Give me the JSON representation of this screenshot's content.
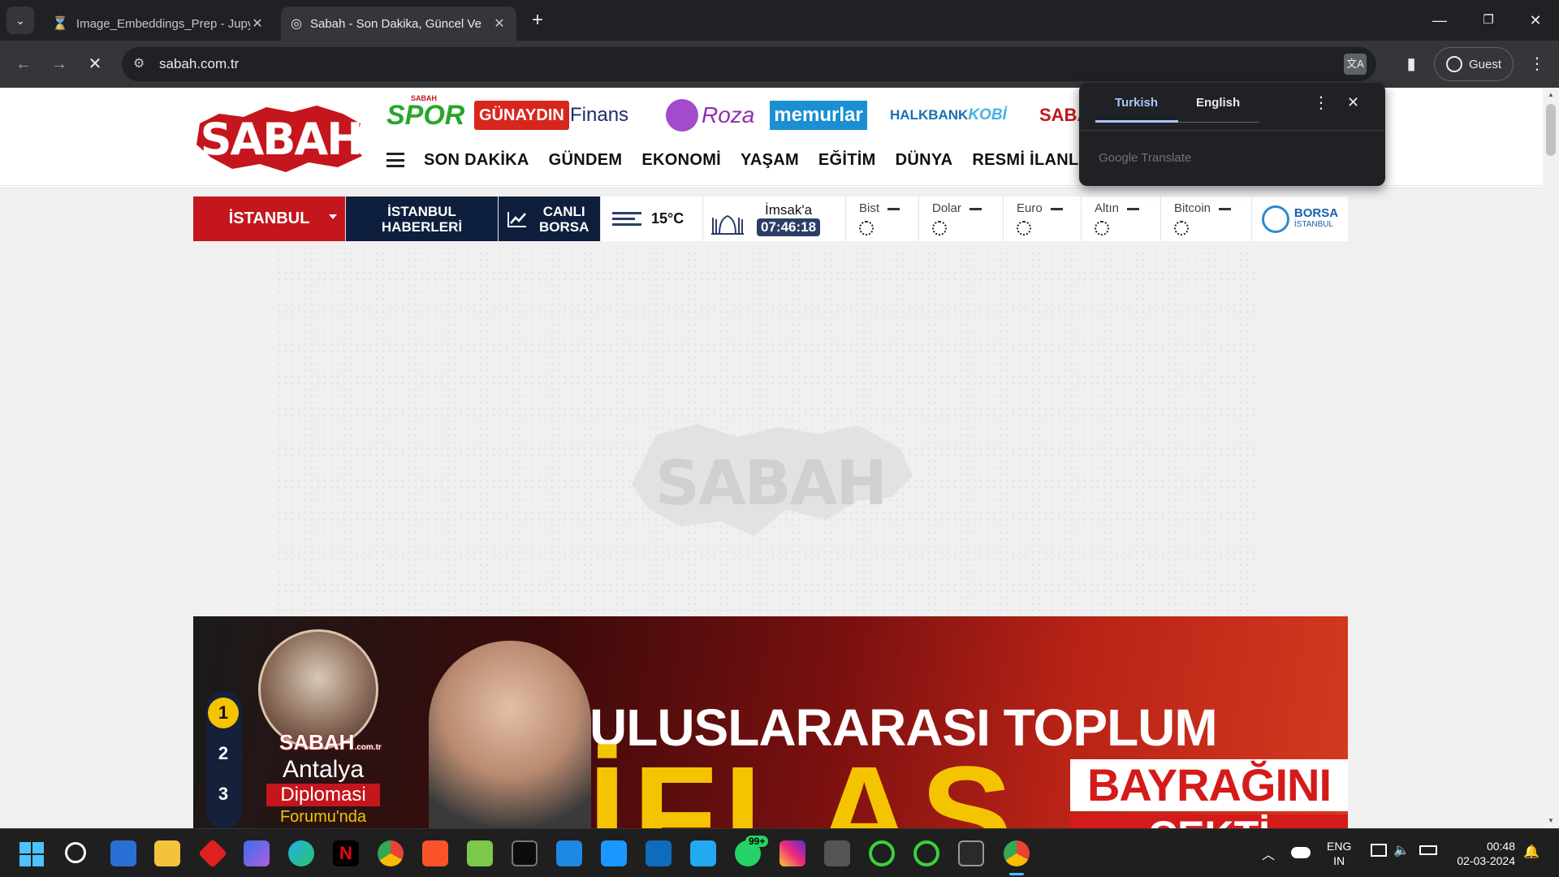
{
  "browser": {
    "tabs": [
      {
        "title": "Image_Embeddings_Prep - Jupy",
        "active": false
      },
      {
        "title": "Sabah - Son Dakika, Güncel Ve",
        "active": true
      }
    ],
    "new_tab": "+",
    "url": "sabah.com.tr",
    "profile_label": "Guest"
  },
  "site": {
    "logo_text": "SABAH",
    "brands": [
      "SPOR",
      "GÜNAYDIN",
      "Finans",
      "Roza",
      "memurlar",
      "HALKBANK",
      "KOBİ",
      "SABAH"
    ],
    "brand_super": "SABAH",
    "nav_items": [
      "SON DAKİKA",
      "GÜNDEM",
      "EKONOMİ",
      "YAŞAM",
      "EĞİTİM",
      "DÜNYA",
      "RESMİ İLANLAR"
    ],
    "city": "İSTANBUL",
    "city_news": [
      "İSTANBUL",
      "HABERLERİ"
    ],
    "live_market": [
      "CANLI",
      "BORSA"
    ],
    "weather": "15°C",
    "prayer_label": "İmsak'a",
    "prayer_countdown": "07:46:18",
    "markets": [
      "Bist",
      "Dolar",
      "Euro",
      "Altın",
      "Bitcoin"
    ],
    "borsa_logo": [
      "BORSA",
      "İSTANBUL"
    ],
    "watermark_text": "SABAH"
  },
  "slider": {
    "numbers": [
      "1",
      "2",
      "3"
    ],
    "badge_logo": "SABAH",
    "badge_logo_sub": ".com.tr",
    "badge_line1": "Antalya",
    "badge_line2": "Diplomasi",
    "badge_line3": "Forumu'nda",
    "headline_top": "ULUSLARARASI TOPLUM",
    "headline_big": "İFLAS",
    "headline_right": "BAYRAĞINI",
    "headline_cut": "ÇEKTİ"
  },
  "translate_popup": {
    "lang_from": "Turkish",
    "lang_to": "English",
    "brand": "Google Translate"
  },
  "taskbar": {
    "lang_top": "ENG",
    "lang_bottom": "IN",
    "time": "00:48",
    "date": "02-03-2024",
    "whatsapp_badge": "99+"
  },
  "colors": {
    "brand_red": "#c4161c",
    "navy": "#0d1f3c",
    "accent_yellow": "#f5c400"
  }
}
